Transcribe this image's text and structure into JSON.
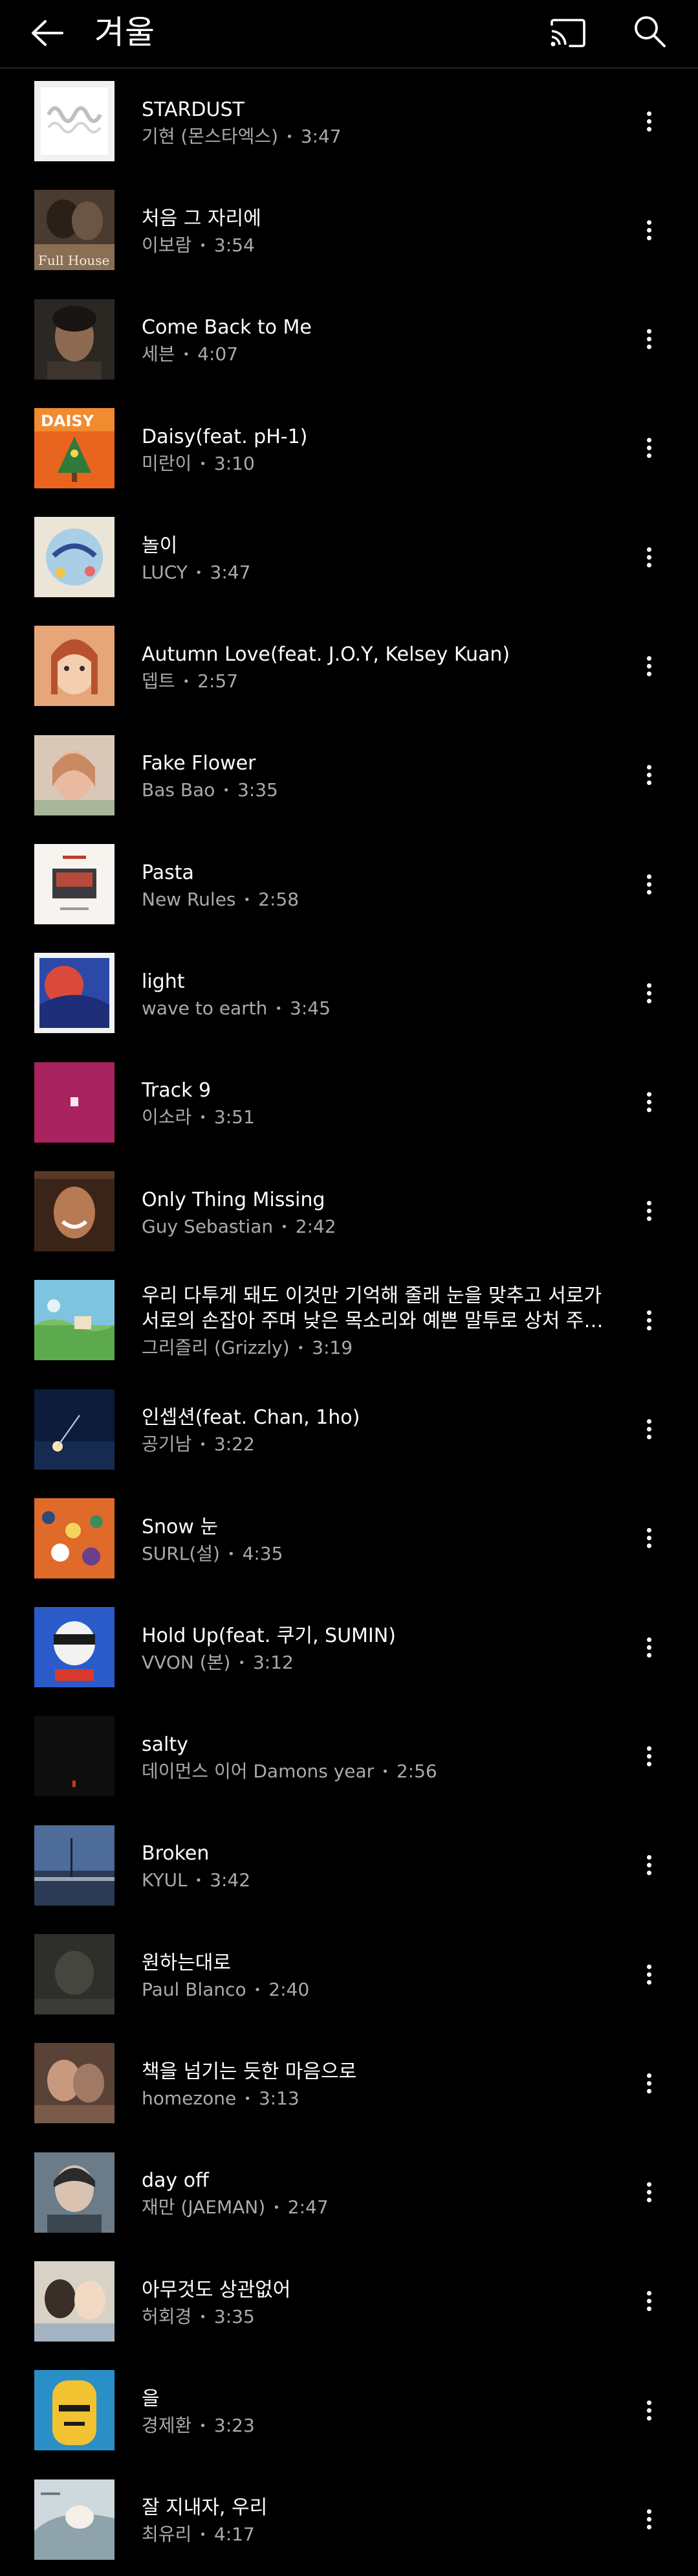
{
  "header": {
    "title": "겨울"
  },
  "songs": [
    {
      "title": "STARDUST",
      "artist": "기현 (몬스타엑스)",
      "duration": "3:47"
    },
    {
      "title": "처음 그 자리에",
      "artist": "이보람",
      "duration": "3:54"
    },
    {
      "title": "Come Back to Me",
      "artist": "세븐",
      "duration": "4:07"
    },
    {
      "title": "Daisy(feat. pH-1)",
      "artist": "미란이",
      "duration": "3:10"
    },
    {
      "title": "놀이",
      "artist": "LUCY",
      "duration": "3:47"
    },
    {
      "title": "Autumn Love(feat. J.O.Y, Kelsey Kuan)",
      "artist": "뎁트",
      "duration": "2:57"
    },
    {
      "title": "Fake Flower",
      "artist": "Bas Bao",
      "duration": "3:35"
    },
    {
      "title": "Pasta",
      "artist": "New Rules",
      "duration": "2:58"
    },
    {
      "title": "light",
      "artist": "wave to earth",
      "duration": "3:45"
    },
    {
      "title": "Track 9",
      "artist": "이소라",
      "duration": "3:51"
    },
    {
      "title": "Only Thing Missing",
      "artist": "Guy Sebastian",
      "duration": "2:42"
    },
    {
      "title": "우리 다투게 돼도 이것만 기억해 줄래 눈을 맞추고 서로가 서로의 손잡아 주며 낮은 목소리와 예쁜 말투로 상처 주지 않…",
      "artist": "그리즐리 (Grizzly)",
      "duration": "3:19"
    },
    {
      "title": "인셉션(feat. Chan, 1ho)",
      "artist": "공기남",
      "duration": "3:22"
    },
    {
      "title": "Snow 눈",
      "artist": "SURL(설)",
      "duration": "4:35"
    },
    {
      "title": "Hold Up(feat. 쿠기, SUMIN)",
      "artist": "VVON (본)",
      "duration": "3:12"
    },
    {
      "title": "salty",
      "artist": "데이먼스 이어 Damons year",
      "duration": "2:56"
    },
    {
      "title": "Broken",
      "artist": "KYUL",
      "duration": "3:42"
    },
    {
      "title": "원하는대로",
      "artist": "Paul Blanco",
      "duration": "2:40"
    },
    {
      "title": "책을 넘기는 듯한 마음으로",
      "artist": "homezone",
      "duration": "3:13"
    },
    {
      "title": "day off",
      "artist": "재만 (JAEMAN)",
      "duration": "2:47"
    },
    {
      "title": "아무것도 상관없어",
      "artist": "허회경",
      "duration": "3:35"
    },
    {
      "title": "을",
      "artist": "경제환",
      "duration": "3:23"
    },
    {
      "title": "잘 지내자, 우리",
      "artist": "최유리",
      "duration": "4:17"
    }
  ],
  "cover_art_text": {
    "full_house": "Full House",
    "daisy": "DAISY"
  },
  "colors": {
    "background": "#000000",
    "text_primary": "#ffffff",
    "text_secondary": "#aaaaaa",
    "divider": "#242424"
  },
  "icons": {
    "back": "arrow-left-icon",
    "cast": "cast-icon",
    "search": "search-icon",
    "more": "more-vertical-icon"
  }
}
